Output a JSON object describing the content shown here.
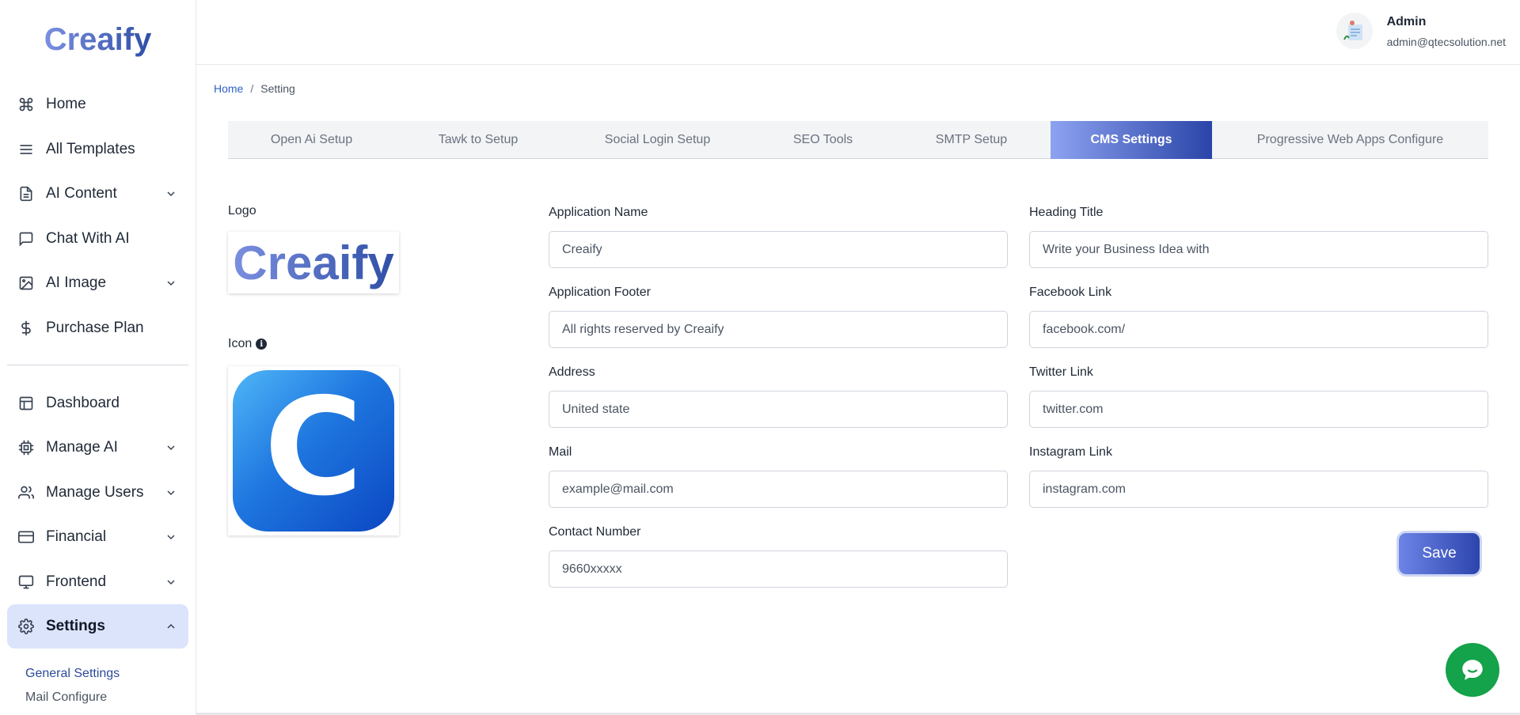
{
  "brand": {
    "name": "Creaify"
  },
  "sidebar": {
    "items": [
      {
        "label": "Home",
        "icon": "command-icon"
      },
      {
        "label": "All Templates",
        "icon": "menu-icon"
      },
      {
        "label": "AI Content",
        "icon": "document-icon",
        "expandable": true
      },
      {
        "label": "Chat With AI",
        "icon": "chat-icon"
      },
      {
        "label": "AI Image",
        "icon": "image-icon",
        "expandable": true
      },
      {
        "label": "Purchase Plan",
        "icon": "dollar-icon"
      }
    ],
    "items2": [
      {
        "label": "Dashboard",
        "icon": "layout-icon"
      },
      {
        "label": "Manage AI",
        "icon": "chip-icon",
        "expandable": true
      },
      {
        "label": "Manage Users",
        "icon": "users-icon",
        "expandable": true
      },
      {
        "label": "Financial",
        "icon": "card-icon",
        "expandable": true
      },
      {
        "label": "Frontend",
        "icon": "monitor-icon",
        "expandable": true
      },
      {
        "label": "Settings",
        "icon": "gear-icon",
        "expandable": true,
        "active": true
      }
    ],
    "sub": [
      "General Settings",
      "Mail Configure"
    ]
  },
  "header": {
    "user_name": "Admin",
    "user_email": "admin@qtecsolution.net"
  },
  "breadcrumb": {
    "home": "Home",
    "sep": "/",
    "current": "Setting"
  },
  "tabs": [
    {
      "label": "Open Ai Setup"
    },
    {
      "label": "Tawk to Setup"
    },
    {
      "label": "Social Login Setup"
    },
    {
      "label": "SEO Tools"
    },
    {
      "label": "SMTP Setup"
    },
    {
      "label": "CMS Settings",
      "active": true
    },
    {
      "label": "Progressive Web Apps Configure"
    }
  ],
  "assets": {
    "logo_label": "Logo",
    "icon_label": "Icon",
    "icon_letter": "C"
  },
  "form": {
    "app_name": {
      "label": "Application Name",
      "value": "Creaify"
    },
    "app_footer": {
      "label": "Application Footer",
      "value": "All rights reserved by Creaify"
    },
    "address": {
      "label": "Address",
      "value": "United state"
    },
    "mail": {
      "label": "Mail",
      "value": "example@mail.com"
    },
    "contact": {
      "label": "Contact Number",
      "value": "9660xxxxx"
    },
    "heading": {
      "label": "Heading Title",
      "value": "Write your Business Idea with"
    },
    "facebook": {
      "label": "Facebook Link",
      "value": "facebook.com/"
    },
    "twitter": {
      "label": "Twitter Link",
      "value": "twitter.com"
    },
    "instagram": {
      "label": "Instagram Link",
      "value": "instagram.com"
    },
    "save_label": "Save"
  },
  "colors": {
    "accent": "#2c45ad",
    "active_nav": "#dbe4fb",
    "chat": "#14a24a"
  }
}
